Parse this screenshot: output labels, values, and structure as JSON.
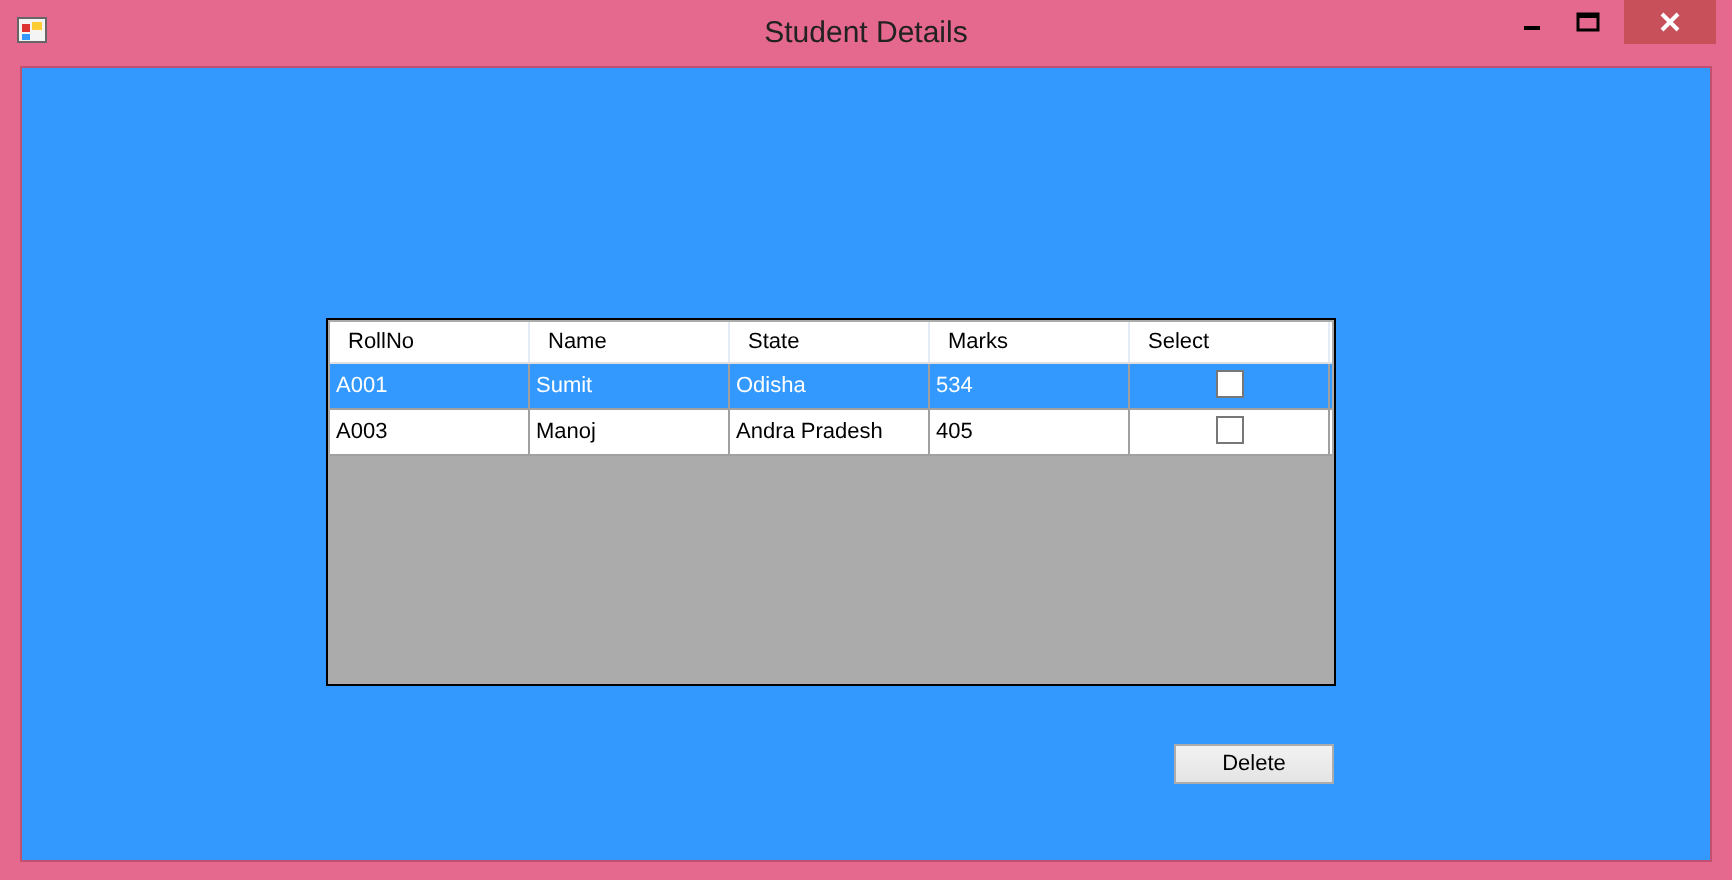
{
  "window": {
    "title": "Student Details"
  },
  "table": {
    "columns": [
      "RollNo",
      "Name",
      "State",
      "Marks",
      "Select"
    ],
    "rows": [
      {
        "cells": [
          "A001",
          "Sumit",
          "Odisha",
          "534"
        ],
        "checked": false,
        "selected": true
      },
      {
        "cells": [
          "A003",
          "Manoj",
          "Andra Pradesh",
          "405"
        ],
        "checked": false,
        "selected": false
      }
    ]
  },
  "buttons": [
    "Delete"
  ]
}
